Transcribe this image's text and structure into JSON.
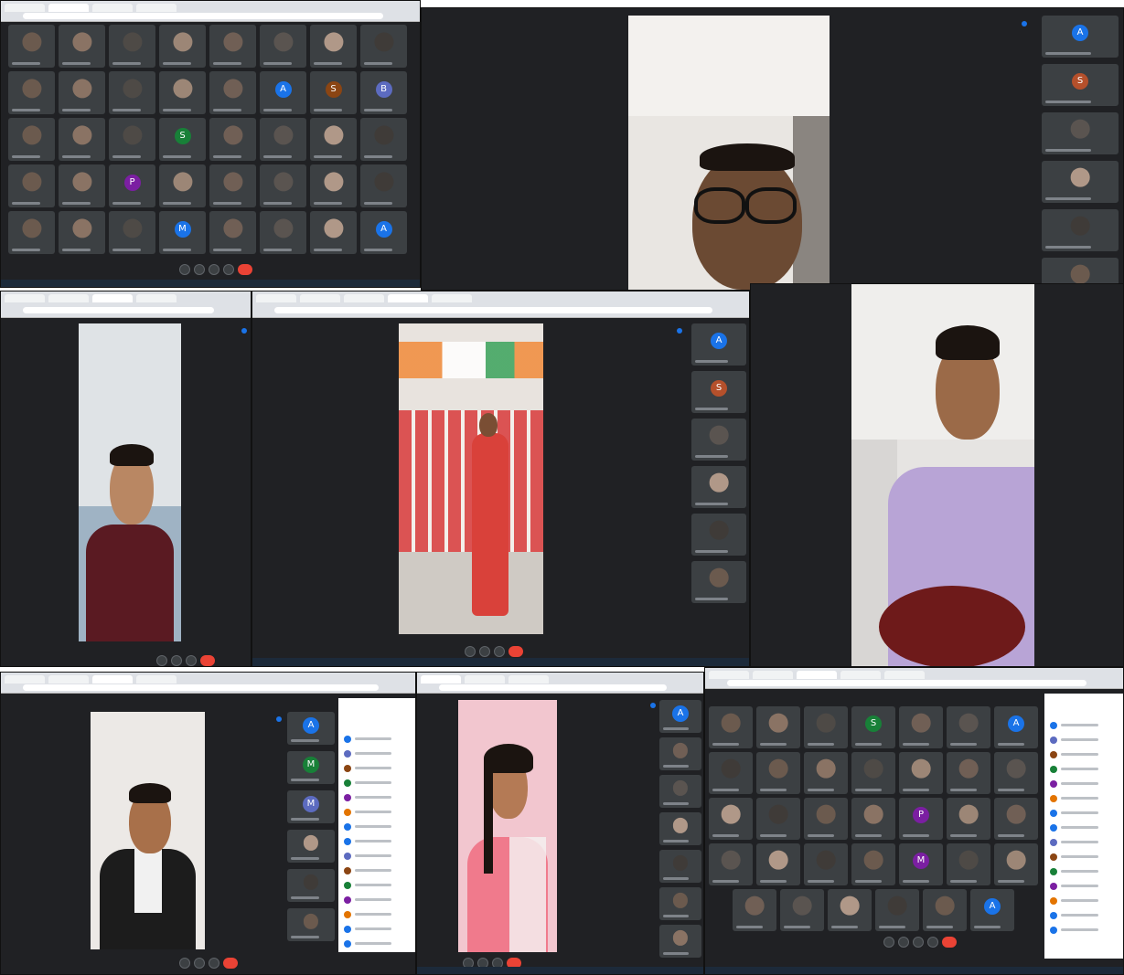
{
  "panels": {
    "p1_grid": {
      "avatars": [
        {
          "letter": "A",
          "color": "#1a73e8"
        },
        {
          "letter": "S",
          "color": "#8b4513"
        },
        {
          "letter": "B",
          "color": "#5c6bc0"
        },
        {
          "letter": "S",
          "color": "#188038"
        },
        {
          "letter": "P",
          "color": "#7b1fa2"
        },
        {
          "letter": "M",
          "color": "#1a73e8"
        },
        {
          "letter": "A",
          "color": "#1a73e8"
        }
      ]
    },
    "p2_strip": {
      "tiles": [
        {
          "letter": "A",
          "color": "#1a73e8"
        },
        {
          "letter": "S",
          "color": "#b5502b"
        }
      ]
    },
    "p4_strip": {
      "tiles": [
        {
          "letter": "A",
          "color": "#1a73e8"
        },
        {
          "letter": "S",
          "color": "#b5502b"
        }
      ]
    },
    "p6_strip": {
      "tiles": [
        {
          "letter": "A",
          "color": "#1a73e8"
        },
        {
          "letter": "M",
          "color": "#188038"
        },
        {
          "letter": "M",
          "color": "#5c6bc0"
        }
      ]
    },
    "p7_strip": {
      "tiles": [
        {
          "letter": "A",
          "color": "#1a73e8"
        }
      ]
    },
    "p8_grid": {
      "avatars": [
        {
          "letter": "S",
          "color": "#188038"
        },
        {
          "letter": "A",
          "color": "#1a73e8"
        },
        {
          "letter": "P",
          "color": "#7b1fa2"
        },
        {
          "letter": "M",
          "color": "#7b1fa2"
        },
        {
          "letter": "A",
          "color": "#1a73e8"
        }
      ]
    }
  },
  "colors": {
    "meet_bg": "#202124",
    "tile_bg": "#3c4043",
    "end_call": "#ea4335",
    "accent": "#1a73e8"
  }
}
